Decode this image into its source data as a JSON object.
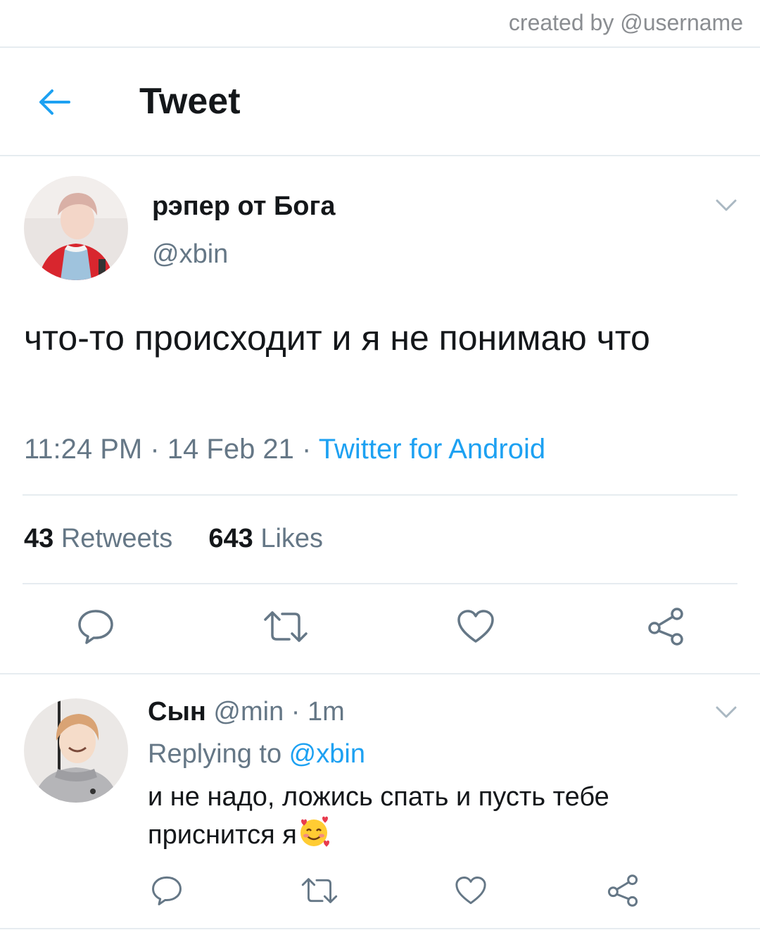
{
  "credit": "created by @username",
  "header": {
    "title": "Tweet",
    "back_icon": "arrow-left-icon"
  },
  "tweet": {
    "display_name": "рэпер от Бога",
    "handle": "@xbin",
    "text": "что-то происходит и я не понимаю что",
    "time": "11:24 PM · 14 Feb 21 · ",
    "source": "Twitter for Android",
    "retweets_count": "43",
    "retweets_label": " Retweets",
    "likes_count": "643",
    "likes_label": " Likes"
  },
  "reply": {
    "display_name": "Сын",
    "handle_time": " @min · 1m",
    "replying_prefix": "Replying to ",
    "replying_to": "@xbin",
    "text": "и не надо, ложись спать и пусть тебе приснится я",
    "emoji": "smiling-face-with-hearts-icon"
  },
  "colors": {
    "accent": "#1da1f2",
    "muted": "#657786",
    "divider": "#e6ecf0",
    "icon_gray": "#657786"
  }
}
